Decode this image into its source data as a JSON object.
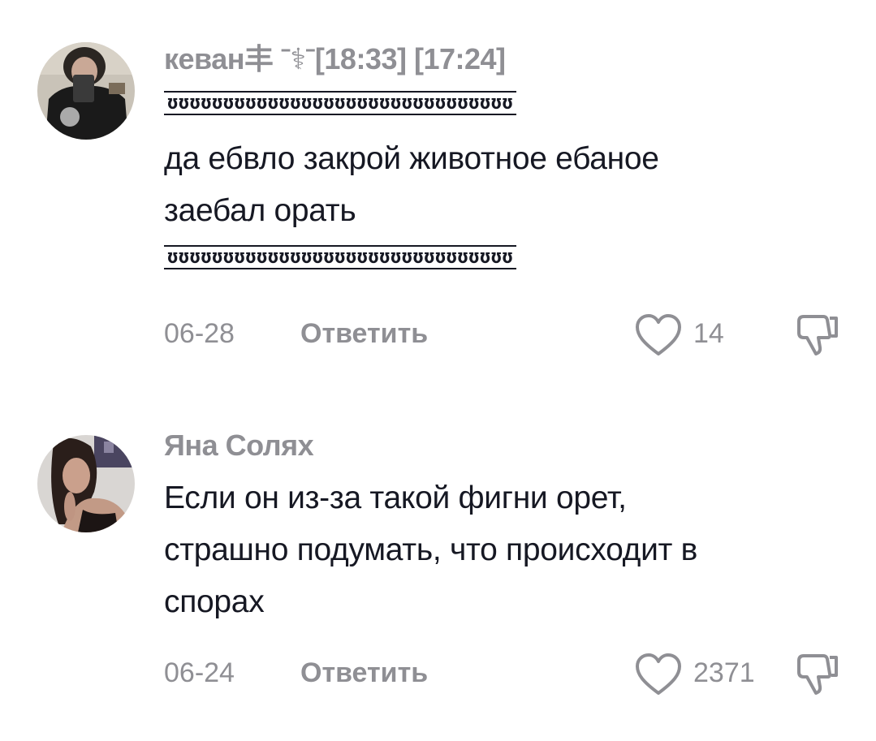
{
  "comments": [
    {
      "username": "кеван丰 ˉ⚕ˉ[18:33] [17:24]",
      "deco_top": "ʊʊʊʊʊʊʊʊʊʊʊʊʊʊʊʊʊʊʊʊʊʊʊʊʊʊʊʊʊʊʊ",
      "text_lines": [
        "да ебвло закрой животное ебаное",
        "заебал орать"
      ],
      "deco_bottom": "ʊʊʊʊʊʊʊʊʊʊʊʊʊʊʊʊʊʊʊʊʊʊʊʊʊʊʊʊʊʊʊ",
      "date": "06-28",
      "reply_label": "Ответить",
      "like_count": "14",
      "icons": {
        "like": "heart-outline-icon",
        "dislike": "thumbs-down-icon"
      }
    },
    {
      "username": "Яна Солях",
      "text_lines": [
        "Если он из-за такой фигни орет,",
        "страшно подумать, что происходит в",
        "спорах"
      ],
      "date": "06-24",
      "reply_label": "Ответить",
      "like_count": "2371",
      "icons": {
        "like": "heart-outline-icon",
        "dislike": "thumbs-down-icon"
      }
    }
  ],
  "colors": {
    "text": "#161823",
    "muted": "#8f8f94",
    "background": "#ffffff"
  }
}
